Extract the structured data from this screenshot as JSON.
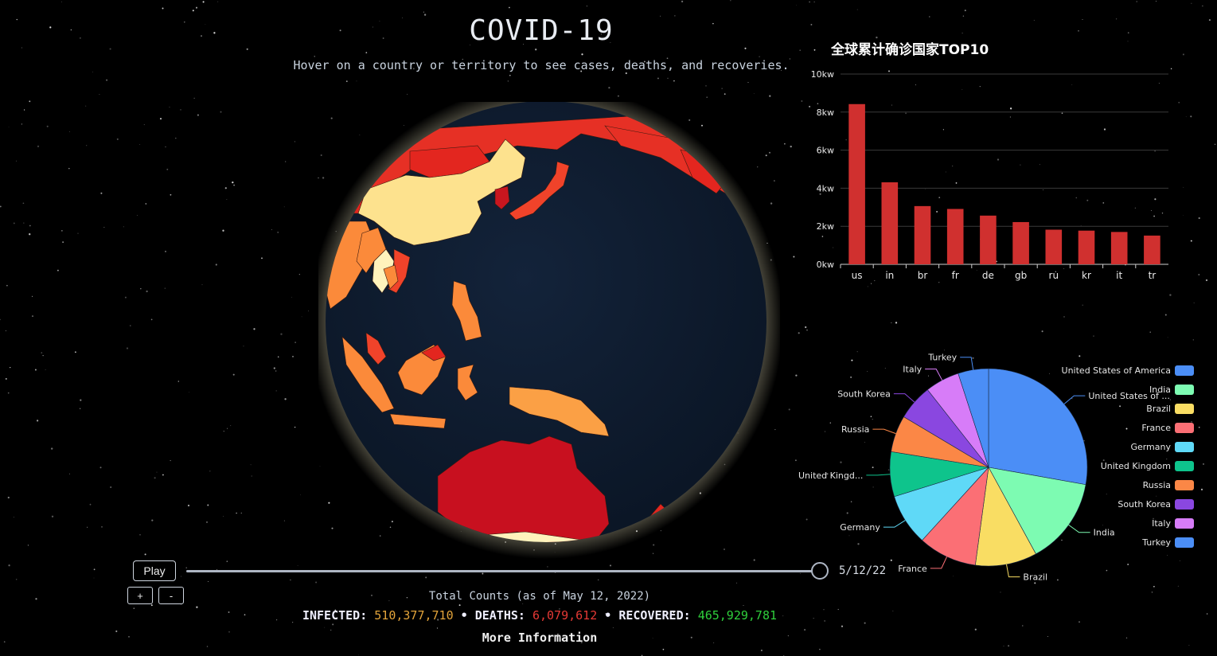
{
  "header": {
    "title": "COVID-19",
    "subtitle": "Hover on a country or territory to see cases, deaths, and recoveries."
  },
  "bar_chart_title": "全球累计确诊国家TOP10",
  "chart_data": [
    {
      "type": "bar",
      "title": "全球累计确诊国家TOP10",
      "categories": [
        "us",
        "in",
        "br",
        "fr",
        "de",
        "gb",
        "ru",
        "kr",
        "it",
        "tr"
      ],
      "values": [
        8420,
        4310,
        3060,
        2910,
        2560,
        2220,
        1820,
        1770,
        1700,
        1510
      ],
      "yticks": [
        "0kw",
        "2kw",
        "4kw",
        "6kw",
        "8kw",
        "10kw"
      ],
      "ylim": [
        0,
        10000
      ],
      "bar_color": "#d0302f",
      "grid": true
    },
    {
      "type": "pie",
      "series": [
        {
          "name": "United States of America",
          "value": 84.2,
          "color": "#4b8ef6"
        },
        {
          "name": "India",
          "value": 43.1,
          "color": "#7dfbb2"
        },
        {
          "name": "Brazil",
          "value": 30.6,
          "color": "#f9dd63"
        },
        {
          "name": "France",
          "value": 29.1,
          "color": "#fb6f75"
        },
        {
          "name": "Germany",
          "value": 25.6,
          "color": "#5fd9f7"
        },
        {
          "name": "United Kingdom",
          "value": 22.2,
          "color": "#0ec48c"
        },
        {
          "name": "Russia",
          "value": 18.2,
          "color": "#fb8746"
        },
        {
          "name": "South Korea",
          "value": 17.7,
          "color": "#8a47e0"
        },
        {
          "name": "Italy",
          "value": 17.0,
          "color": "#d77cf8"
        },
        {
          "name": "Turkey",
          "value": 15.1,
          "color": "#4b8ef6"
        }
      ],
      "slice_labels": [
        "United States of ...",
        "India",
        "Brazil",
        "France",
        "Germany",
        "United Kingd...",
        "Russia",
        "South Korea",
        "Italy",
        "Turkey"
      ],
      "legend_placement": "right"
    }
  ],
  "controls": {
    "play_label": "Play",
    "zoom_in_label": "+",
    "zoom_out_label": "-",
    "date_label": "5/12/22",
    "timeline_progress": 1.0
  },
  "totals": {
    "caption": "Total Counts (as of May 12, 2022)",
    "infected_label": "INFECTED:",
    "infected_value": "510,377,710",
    "deaths_label": "DEATHS:",
    "deaths_value": "6,079,612",
    "recovered_label": "RECOVERED:",
    "recovered_value": "465,929,781",
    "separator": "•",
    "colors": {
      "infected": "#e3a43a",
      "deaths": "#e53935",
      "recovered": "#2fcf3c"
    }
  },
  "more_info_label": "More Information"
}
